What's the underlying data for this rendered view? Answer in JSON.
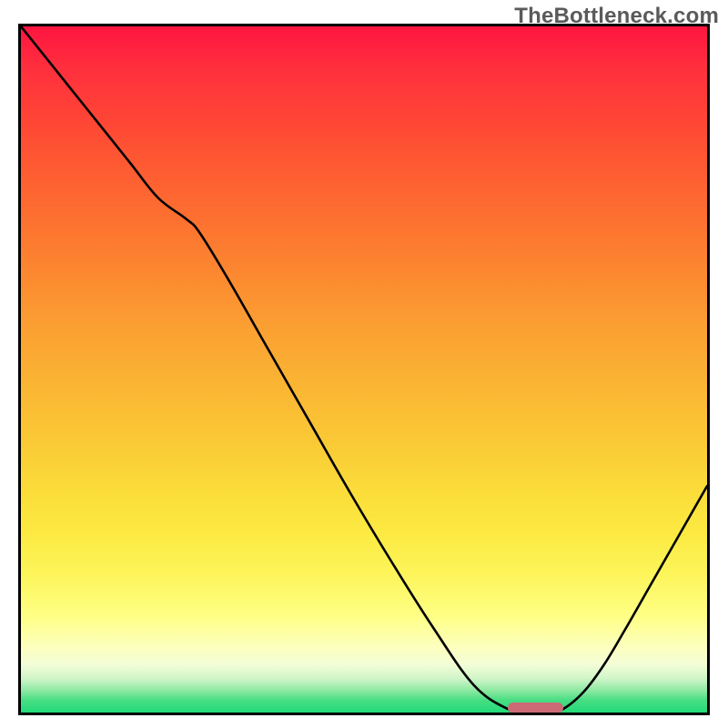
{
  "watermark": "TheBottleneck.com",
  "colors": {
    "curve": "#000000",
    "marker": "#cc6a76",
    "border": "#000000"
  },
  "chart_data": {
    "type": "line",
    "title": "",
    "xlabel": "",
    "ylabel": "",
    "xlim": [
      0,
      100
    ],
    "ylim": [
      0,
      100
    ],
    "background_gradient": {
      "direction": "top-to-bottom",
      "stops": [
        {
          "pos": 0,
          "color": "#fe1540"
        },
        {
          "pos": 20,
          "color": "#fd7030"
        },
        {
          "pos": 40,
          "color": "#fba032"
        },
        {
          "pos": 60,
          "color": "#fac835"
        },
        {
          "pos": 80,
          "color": "#fdf55b"
        },
        {
          "pos": 90,
          "color": "#fdffbf"
        },
        {
          "pos": 100,
          "color": "#22da78"
        }
      ]
    },
    "series": [
      {
        "name": "bottleneck-curve",
        "x": [
          0,
          4,
          8,
          12,
          16,
          20,
          24,
          26,
          30,
          36,
          42,
          48,
          54,
          60,
          66,
          71,
          74,
          77,
          79,
          82,
          85,
          88,
          92,
          96,
          100
        ],
        "y": [
          100,
          95,
          90,
          85,
          80,
          75,
          72,
          70,
          63.5,
          53,
          42.5,
          32,
          22,
          12.5,
          4,
          0.5,
          0,
          0,
          0.5,
          3,
          7,
          12,
          19,
          26,
          33
        ]
      }
    ],
    "marker": {
      "name": "optimal-range",
      "x_start": 71,
      "x_end": 79,
      "y": 0.6,
      "color": "#cc6a76"
    }
  }
}
